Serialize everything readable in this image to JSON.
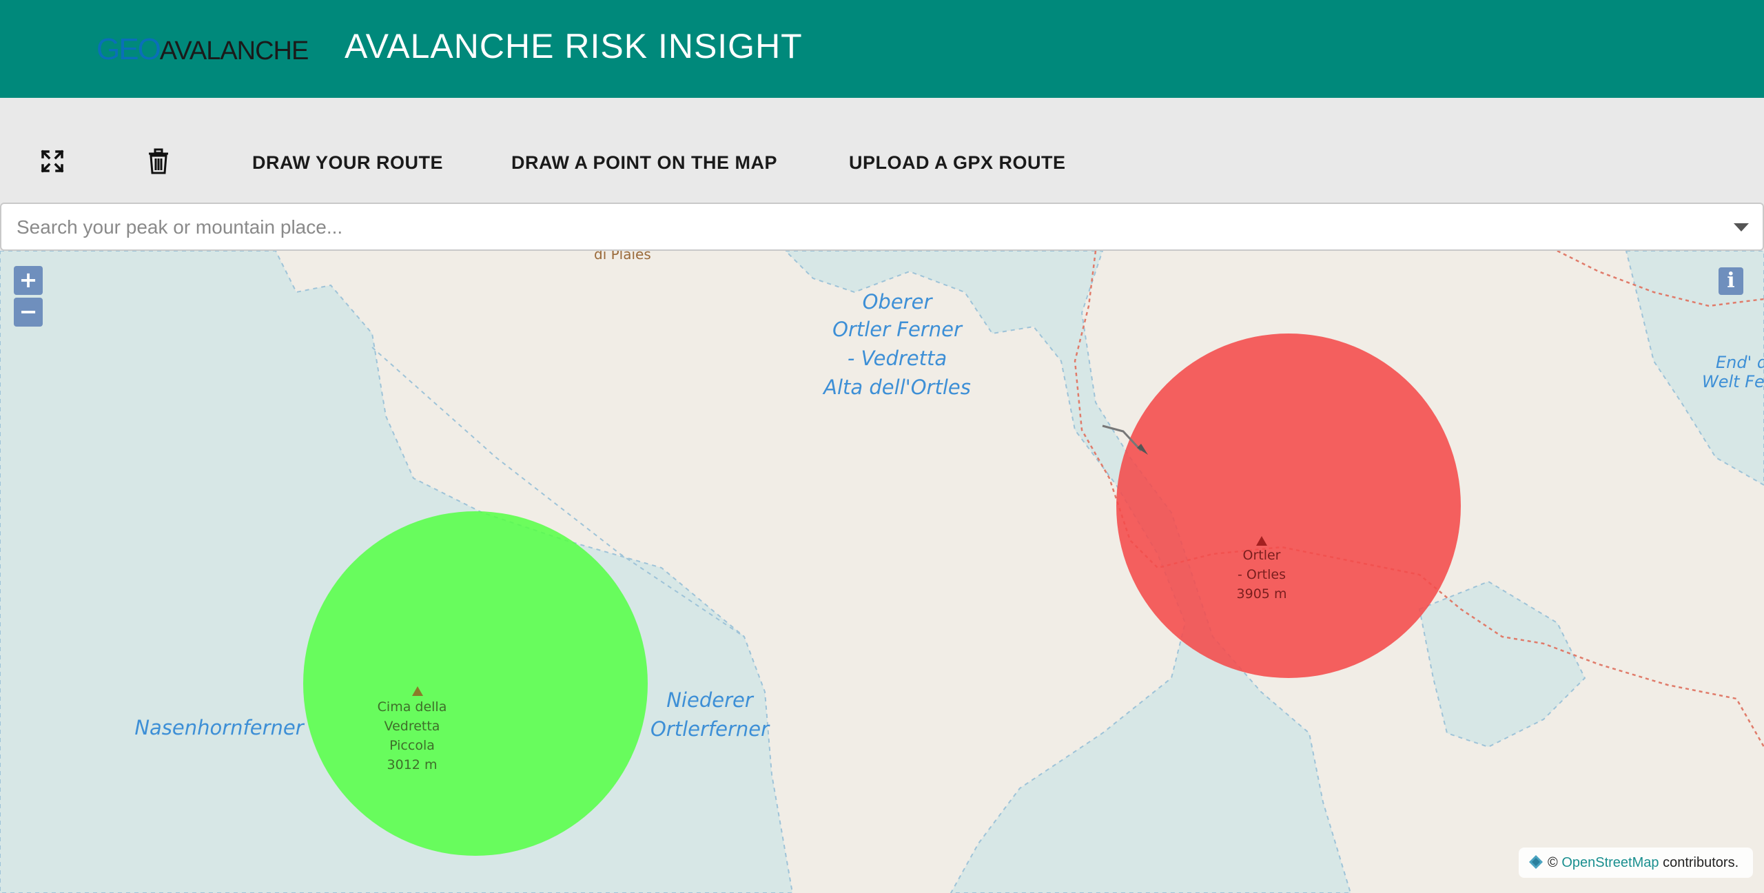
{
  "header": {
    "logo_geo": "GEO",
    "logo_avalanche": "AVALANCHE",
    "title": "AVALANCHE RISK INSIGHT",
    "color": "#00897b"
  },
  "toolbar": {
    "fullscreen_icon": "fullscreen-icon",
    "delete_icon": "trash-icon",
    "draw_route_label": "DRAW YOUR ROUTE",
    "draw_point_label": "DRAW A POINT ON THE MAP",
    "upload_gpx_label": "UPLOAD A GPX ROUTE"
  },
  "search": {
    "placeholder": "Search your peak or mountain place..."
  },
  "map": {
    "zoom_in": "+",
    "zoom_out": "−",
    "info": "i",
    "labels": {
      "oberer_1": "Oberer",
      "oberer_2": "Ortler Ferner",
      "oberer_3": "- Vedretta",
      "oberer_4": "Alta dell'Ortles",
      "nasenhornferner": "Nasenhornferner",
      "niederer_1": "Niederer",
      "niederer_2": "Ortlerferner",
      "end_1": "End' d",
      "end_2": "Welt Fe",
      "top_cut": "di Plaies"
    },
    "peaks": [
      {
        "name_lines": [
          "Cima della",
          "Vedretta",
          "Piccola"
        ],
        "elevation": "3012 m",
        "risk_color": "#55ff44"
      },
      {
        "name_lines": [
          "Ortler",
          "- Ortles"
        ],
        "elevation": "3905 m",
        "risk_color": "#f44b4b"
      }
    ],
    "attribution": {
      "prefix": "©",
      "link": "OpenStreetMap",
      "suffix": "contributors."
    },
    "colors": {
      "land": "#f1ede6",
      "glacier": "#d7e7e6",
      "glacier_label": "#3d8fd6"
    }
  }
}
